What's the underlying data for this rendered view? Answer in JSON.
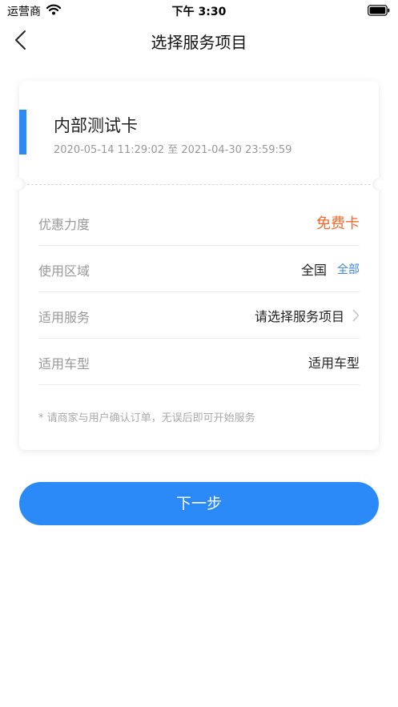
{
  "status_bar": {
    "carrier": "运营商",
    "time": "下午 3:30",
    "icons": [
      "wifi-icon",
      "battery-icon"
    ]
  },
  "nav": {
    "back_icon": "chevron-left-icon",
    "title": "选择服务项目"
  },
  "card": {
    "name": "内部测试卡",
    "period": "2020-05-14 11:29:02 至 2021-04-30 23:59:59",
    "accent_color": "#2b8af7",
    "rows": {
      "discount": {
        "label": "优惠力度",
        "value": "免费卡",
        "value_color": "#f26a2b"
      },
      "region": {
        "label": "使用区域",
        "value": "全国",
        "link": "全部"
      },
      "service": {
        "label": "适用服务",
        "value": "请选择服务项目",
        "icon": "chevron-right-icon"
      },
      "vehicle": {
        "label": "适用车型",
        "value": "适用车型"
      }
    },
    "notice": "* 请商家与用户确认订单，无误后即可开始服务"
  },
  "footer": {
    "next_label": "下一步",
    "button_color": "#2b8af7"
  }
}
